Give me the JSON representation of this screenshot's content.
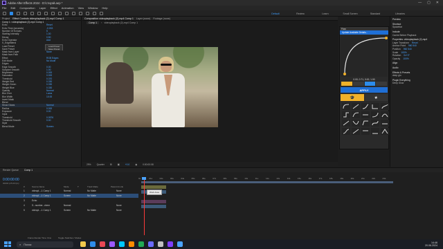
{
  "window": {
    "title": "Adobe After Effects 2024 - D:\\стиуой.aep *",
    "controls": [
      "—",
      "▢",
      "✕"
    ]
  },
  "menu": [
    "File",
    "Edit",
    "Composition",
    "Layer",
    "Effect",
    "Animation",
    "View",
    "Window",
    "Help"
  ],
  "workspaces": [
    "Default",
    "Review",
    "Learn",
    "Small Screen",
    "Standard",
    "Libraries"
  ],
  "effect_controls": {
    "tabs": [
      "Project",
      "Effect Controls videoplayback (2)-mp4 Comp 1"
    ],
    "layer_path": "Comp 1 • videoplayback (2)-mp4 Comp 1",
    "rows": [
      {
        "label": "Echo",
        "value": "Reset"
      },
      {
        "label": "Echo Time (seconds)",
        "value": "-0.033"
      },
      {
        "label": "Number Of Echoes",
        "value": "5"
      },
      {
        "label": "Starting Intensity",
        "value": "1.00"
      },
      {
        "label": "Decay",
        "value": "0.50"
      },
      {
        "label": "Echo Operator",
        "value": "Add"
      },
      {
        "label": "S_EdgeBlend",
        "value": ""
      },
      {
        "label": "Load Preset",
        "value": "Load Preset"
      },
      {
        "label": "Save Preset",
        "value": "Save Preset"
      },
      {
        "label": "Mask from Layer",
        "value": "None"
      },
      {
        "label": "Mask from Path",
        "value": ""
      },
      {
        "label": "Effect",
        "value": "RGB Edges"
      },
      {
        "label": "Edit Mode",
        "value": "No Mode"
      },
      {
        "label": "Edges",
        "value": ""
      },
      {
        "label": "Edge Smooth",
        "value": "0.00"
      },
      {
        "label": "Subpixel Smooth",
        "value": "1.00"
      },
      {
        "label": "Brightness",
        "value": "0.000"
      },
      {
        "label": "Saturation",
        "value": "0.000"
      },
      {
        "label": "Threshold",
        "value": "0.370"
      },
      {
        "label": "Weight Red",
        "value": "0.330"
      },
      {
        "label": "Weight Green",
        "value": "0.330"
      },
      {
        "label": "Weight Blue",
        "value": "0.330"
      },
      {
        "label": "Opacity",
        "value": "Normal"
      },
      {
        "label": "Blur Over",
        "value": "Luma"
      },
      {
        "label": "Blur Width",
        "value": "10.00"
      },
      {
        "label": "Invert Mask",
        "value": ""
      },
      {
        "label": "Blend",
        "value": ""
      },
      {
        "label": "Show Glows",
        "value": "Normal"
      },
      {
        "label": "Radius",
        "value": "0.000"
      },
      {
        "label": "Exposure",
        "value": "0.00"
      },
      {
        "label": "Input",
        "value": ""
      },
      {
        "label": "Threshold",
        "value": "0.0576"
      },
      {
        "label": "Threshold Smooth",
        "value": "0.00"
      },
      {
        "label": "Style",
        "value": ""
      },
      {
        "label": "Blend Mode",
        "value": "Screen"
      }
    ]
  },
  "composition": {
    "tab": "Composition videoplayback (2)-mp4 Comp 1",
    "breadcrumbs": [
      "Comp 1",
      "videoplayback (2)-mp4 Comp 1"
    ],
    "other_tabs": [
      "Layer (none)",
      "Footage (none)"
    ],
    "footer": {
      "zoom": "29%",
      "resolution": "Quarter",
      "timecode": "+0.0",
      "frame": "0:00:00:08"
    }
  },
  "plugin": {
    "title": "Flow",
    "update_text": "Update Available  Details...",
    "curve_values": "0.00, 0.71, 0.00, 1.00",
    "apply_label": "APPLY",
    "tabs": [
      "graduation-cap-icon",
      "star-icon"
    ],
    "curve_color": "#e8e8e8"
  },
  "right_panel": {
    "sections": [
      {
        "title": "Preview",
        "rows": []
      },
      {
        "title": "Shortcut",
        "rows": [
          {
            "label": "Spacebar",
            "value": ""
          }
        ]
      },
      {
        "title": "Include",
        "rows": [
          {
            "label": "Cache Before Playback",
            "value": ""
          }
        ]
      },
      {
        "title": "Properties: videoplayback (2)-mp4",
        "rows": [
          {
            "label": "Layer Transform",
            "value": "Reset"
          },
          {
            "label": "Anchor Point",
            "value": "960  540"
          },
          {
            "label": "Position",
            "value": "960  540"
          },
          {
            "label": "Scale",
            "value": "100%"
          },
          {
            "label": "Rotation",
            "value": "0x+0°"
          },
          {
            "label": "Opacity",
            "value": "100%"
          }
        ]
      },
      {
        "title": "Align",
        "rows": []
      },
      {
        "title": "Audio",
        "rows": []
      },
      {
        "title": "Effects & Presets",
        "rows": [
          {
            "label": "deep glo",
            "value": ""
          }
        ]
      },
      {
        "title": "Plugin Everything",
        "rows": [
          {
            "label": "Deep Glow",
            "value": ""
          }
        ]
      }
    ]
  },
  "timeline": {
    "tabs": [
      "Render Queue",
      "Comp 1"
    ],
    "current_time": "0:00:00:00",
    "fps_info": "00000 (25.00 fps)",
    "columns": [
      "#",
      "Source Name",
      "Mode",
      "T",
      "Track Matte",
      "Parent & Link"
    ],
    "layers": [
      {
        "num": "1",
        "name": "videopl...-1 Comp 1",
        "mode": "Normal",
        "matte": "No Matte",
        "parent": "None"
      },
      {
        "num": "2",
        "name": "videopl...-1 Comp 1",
        "mode": "Screen",
        "matte": "No Matte",
        "parent": "None",
        "selected": true
      },
      {
        "num": "3",
        "name": "Echo",
        "mode": "",
        "matte": "",
        "parent": ""
      },
      {
        "num": "4",
        "name": "S...number...chem",
        "mode": "Normal",
        "matte": "",
        "parent": "None"
      },
      {
        "num": "5",
        "name": "videopl...-1 Comp 1",
        "mode": "Screen",
        "matte": "No Matte",
        "parent": "None"
      }
    ],
    "ruler": [
      "0s",
      "01s",
      "02s",
      "03s",
      "04s",
      "05s",
      "06s",
      "07s",
      "08s",
      "09s",
      "10s",
      "11s",
      "12s",
      "13s",
      "14s",
      "15s",
      "16s",
      "17s",
      "18s",
      "19s",
      "20s",
      "21s",
      "22s",
      "23s"
    ],
    "tooltip": "Work Area",
    "footer": [
      "Frame Render Time: 0ms",
      "Toggle Switches / Modes"
    ]
  },
  "taskbar": {
    "search_placeholder": "Поиск",
    "time": "14:46",
    "date": "20.06.2024",
    "icon_colors": [
      "#f2c94c",
      "#2d8ceb",
      "#e84855",
      "#9b59ff",
      "#00c8ff",
      "#ff8c00",
      "#22aa55",
      "#6b6bff",
      "#c0c0c0",
      "#7e3fff",
      "#4aa3ff"
    ]
  }
}
